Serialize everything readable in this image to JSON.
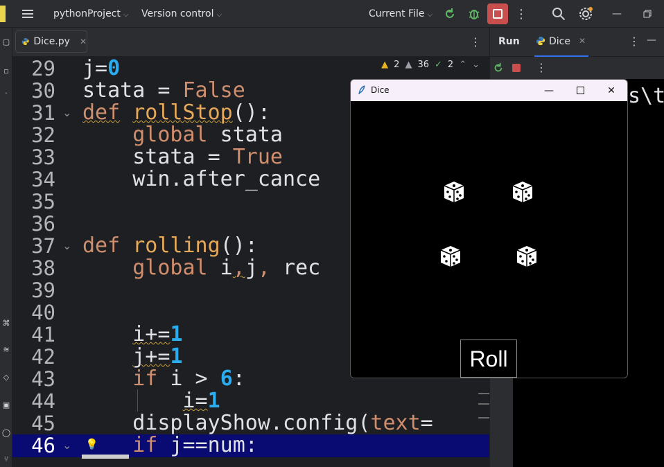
{
  "titlebar": {
    "project": "pythonProject",
    "vcs": "Version control",
    "run_config": "Current File"
  },
  "editor": {
    "tab_label": "Dice.py",
    "inspections": {
      "warnings": "2",
      "weak_warnings": "36",
      "typos": "2"
    },
    "lines": [
      {
        "n": "29"
      },
      {
        "n": "30"
      },
      {
        "n": "31"
      },
      {
        "n": "32"
      },
      {
        "n": "33"
      },
      {
        "n": "34"
      },
      {
        "n": "35"
      },
      {
        "n": "36"
      },
      {
        "n": "37"
      },
      {
        "n": "38"
      },
      {
        "n": "39"
      },
      {
        "n": "40"
      },
      {
        "n": "41"
      },
      {
        "n": "42"
      },
      {
        "n": "43"
      },
      {
        "n": "44"
      },
      {
        "n": "45"
      },
      {
        "n": "46"
      }
    ]
  },
  "run_panel": {
    "tab_run": "Run",
    "tab_dice": "Dice",
    "console_fragment": "s\\t"
  },
  "dice_window": {
    "title": "Dice",
    "button": "Roll"
  }
}
